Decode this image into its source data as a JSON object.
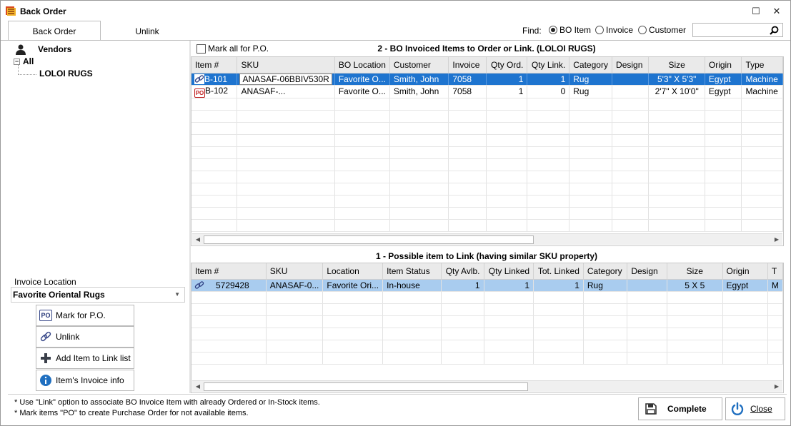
{
  "window": {
    "title": "Back Order"
  },
  "tabs": [
    "Back Order",
    "Unlink"
  ],
  "find": {
    "label": "Find:",
    "options": [
      "BO Item",
      "Invoice",
      "Customer"
    ],
    "selected": "BO Item",
    "search_value": ""
  },
  "left": {
    "vendors_label": "Vendors",
    "tree_root": "All",
    "tree_child": "LOLOI RUGS",
    "invoice_location_label": "Invoice Location",
    "invoice_location_value": "Favorite Oriental Rugs",
    "buttons": {
      "mark_po": "Mark for P.O.",
      "unlink": "Unlink",
      "add_item": "Add Item to Link list",
      "invoice_info": "Item's Invoice info"
    }
  },
  "top": {
    "mark_all": "Mark all for P.O.",
    "title": "2 - BO Invoiced Items to Order or Link.  (LOLOI RUGS)",
    "columns": [
      "Item #",
      "SKU",
      "BO Location",
      "Customer",
      "Invoice",
      "Qty Ord.",
      "Qty Link.",
      "Category",
      "Design",
      "Size",
      "Origin",
      "Type"
    ],
    "rows": [
      {
        "icon": "link-icon",
        "cells": [
          "B-101",
          "ANASAF-06BBIV530R",
          "Favorite O...",
          "Smith, John",
          "7058",
          "1",
          "1",
          "Rug",
          "",
          "5'3\" X 5'3\"",
          "Egypt",
          "Machine"
        ]
      },
      {
        "icon": "po-icon",
        "po_text": "PO",
        "cells": [
          "B-102",
          "ANASAF-...",
          "Favorite O...",
          "Smith, John",
          "7058",
          "1",
          "0",
          "Rug",
          "",
          "2'7\" X 10'0\"",
          "Egypt",
          "Machine"
        ]
      }
    ]
  },
  "bottom": {
    "title": "1 - Possible item to Link (having similar SKU property)",
    "columns": [
      "Item #",
      "SKU",
      "Location",
      "Item Status",
      "Qty Avlb.",
      "Qty Linked",
      "Tot. Linked",
      "Category",
      "Design",
      "Size",
      "Origin",
      "T"
    ],
    "rows": [
      {
        "icon": "link-icon",
        "cells": [
          "5729428",
          "ANASAF-0...",
          "Favorite Ori...",
          "In-house",
          "1",
          "1",
          "1",
          "Rug",
          "",
          "5 X 5",
          "Egypt",
          "M"
        ]
      }
    ]
  },
  "footer": {
    "hint1": "* Use \"Link\" option to associate BO Invoice Item with already Ordered or In-Stock items.",
    "hint2": "* Mark items \"PO\" to create Purchase Order for not available items.",
    "complete": "Complete",
    "close": "Close"
  },
  "colors": {
    "selection": "#1e74cf",
    "highlight": "#a9ccef",
    "header_bg": "#eaeaea"
  }
}
